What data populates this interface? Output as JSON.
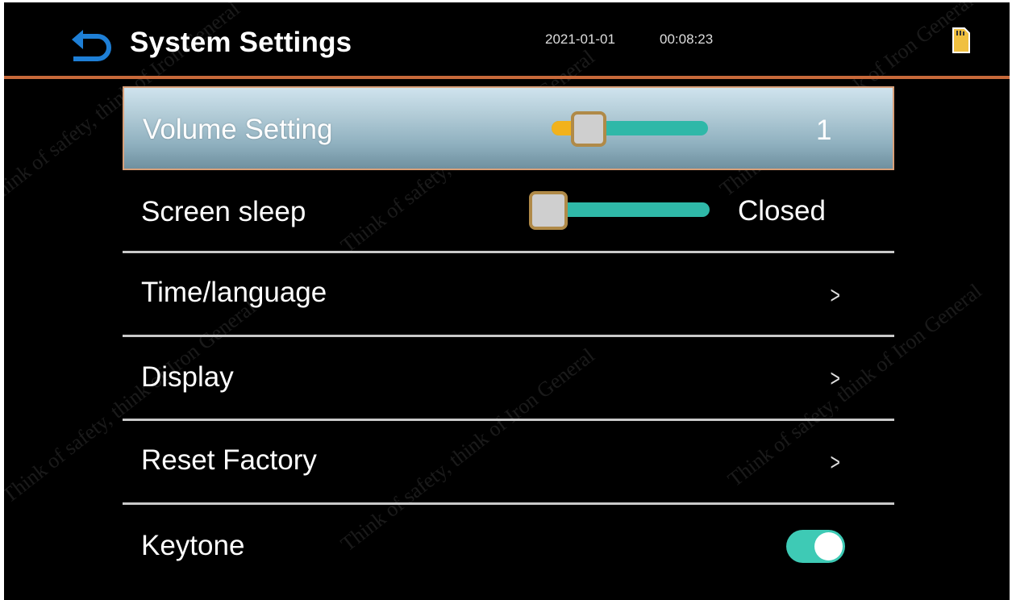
{
  "header": {
    "title": "System Settings",
    "date": "2021-01-01",
    "time": "00:08:23",
    "back_icon": "back-arrow-icon",
    "sd_icon": "sd-card-icon"
  },
  "rows": {
    "volume": {
      "label": "Volume Setting",
      "value": "1",
      "level": 0.12
    },
    "sleep": {
      "label": "Screen sleep",
      "value": "Closed",
      "level": 0
    },
    "time_language": {
      "label": "Time/language",
      "chevron": ">"
    },
    "display": {
      "label": "Display",
      "chevron": ">"
    },
    "reset": {
      "label": "Reset Factory",
      "chevron": ">"
    },
    "keytone": {
      "label": "Keytone",
      "enabled": true
    }
  },
  "watermark": "Think of safety, think of Iron General",
  "colors": {
    "accent_line": "#c8693a",
    "slider_track": "#2fb8a8",
    "slider_fill": "#f2b21c",
    "toggle_on": "#3ecab5",
    "back_icon": "#1e7fd6"
  }
}
